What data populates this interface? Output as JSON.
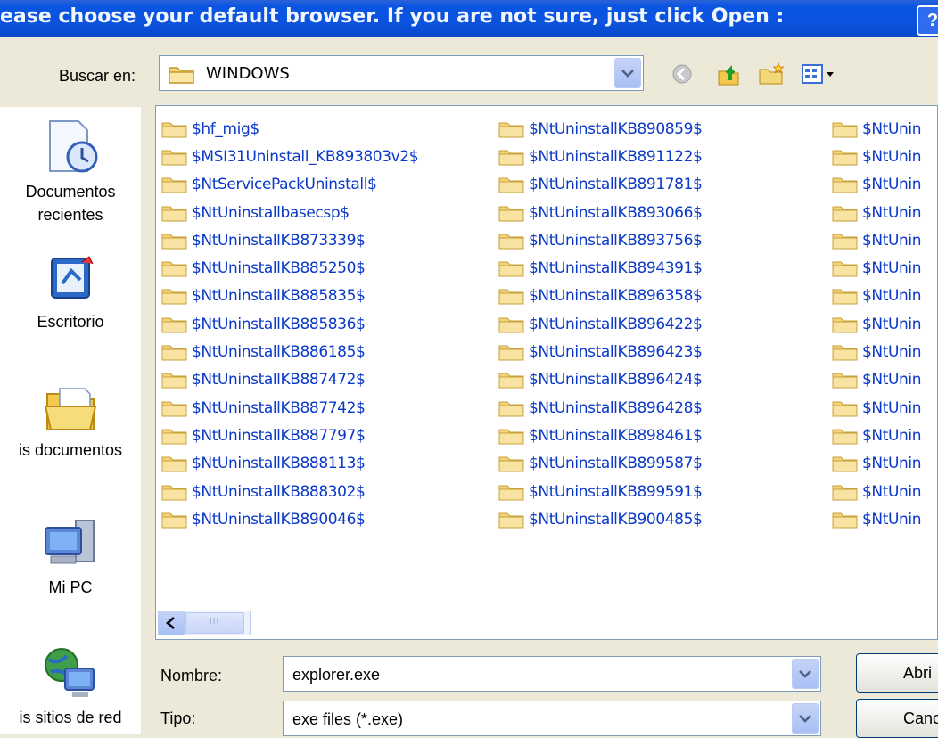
{
  "titlebar": {
    "title": "ease choose your default browser. If you are not sure, just click Open :",
    "help_label": "?"
  },
  "lookin": {
    "label": "Buscar en:",
    "value": "WINDOWS"
  },
  "toolbar": {
    "icons": [
      "back-icon",
      "up-folder-icon",
      "new-folder-icon",
      "view-menu-icon"
    ]
  },
  "places": [
    {
      "label": "Documentos",
      "label2": "recientes",
      "icon": "recent-documents-icon"
    },
    {
      "label": "Escritorio",
      "icon": "desktop-icon"
    },
    {
      "label": "is documentos",
      "icon": "my-documents-icon"
    },
    {
      "label": "Mi PC",
      "icon": "my-computer-icon"
    },
    {
      "label": "is sitios de red",
      "icon": "network-places-icon"
    }
  ],
  "files": {
    "col1": [
      "$hf_mig$",
      "$MSI31Uninstall_KB893803v2$",
      "$NtServicePackUninstall$",
      "$NtUninstallbasecsp$",
      "$NtUninstallKB873339$",
      "$NtUninstallKB885250$",
      "$NtUninstallKB885835$",
      "$NtUninstallKB885836$",
      "$NtUninstallKB886185$",
      "$NtUninstallKB887472$",
      "$NtUninstallKB887742$",
      "$NtUninstallKB887797$",
      "$NtUninstallKB888113$",
      "$NtUninstallKB888302$",
      "$NtUninstallKB890046$"
    ],
    "col2": [
      "$NtUninstallKB890859$",
      "$NtUninstallKB891122$",
      "$NtUninstallKB891781$",
      "$NtUninstallKB893066$",
      "$NtUninstallKB893756$",
      "$NtUninstallKB894391$",
      "$NtUninstallKB896358$",
      "$NtUninstallKB896422$",
      "$NtUninstallKB896423$",
      "$NtUninstallKB896424$",
      "$NtUninstallKB896428$",
      "$NtUninstallKB898461$",
      "$NtUninstallKB899587$",
      "$NtUninstallKB899591$",
      "$NtUninstallKB900485$"
    ],
    "col3": [
      "$NtUnin",
      "$NtUnin",
      "$NtUnin",
      "$NtUnin",
      "$NtUnin",
      "$NtUnin",
      "$NtUnin",
      "$NtUnin",
      "$NtUnin",
      "$NtUnin",
      "$NtUnin",
      "$NtUnin",
      "$NtUnin",
      "$NtUnin",
      "$NtUnin"
    ]
  },
  "scrollbar": {
    "thumb_grip": "III"
  },
  "filename": {
    "label": "Nombre:",
    "value": "explorer.exe"
  },
  "filetype": {
    "label": "Tipo:",
    "value": "exe files (*.exe)"
  },
  "buttons": {
    "open": "Abri",
    "cancel": "Cance"
  }
}
